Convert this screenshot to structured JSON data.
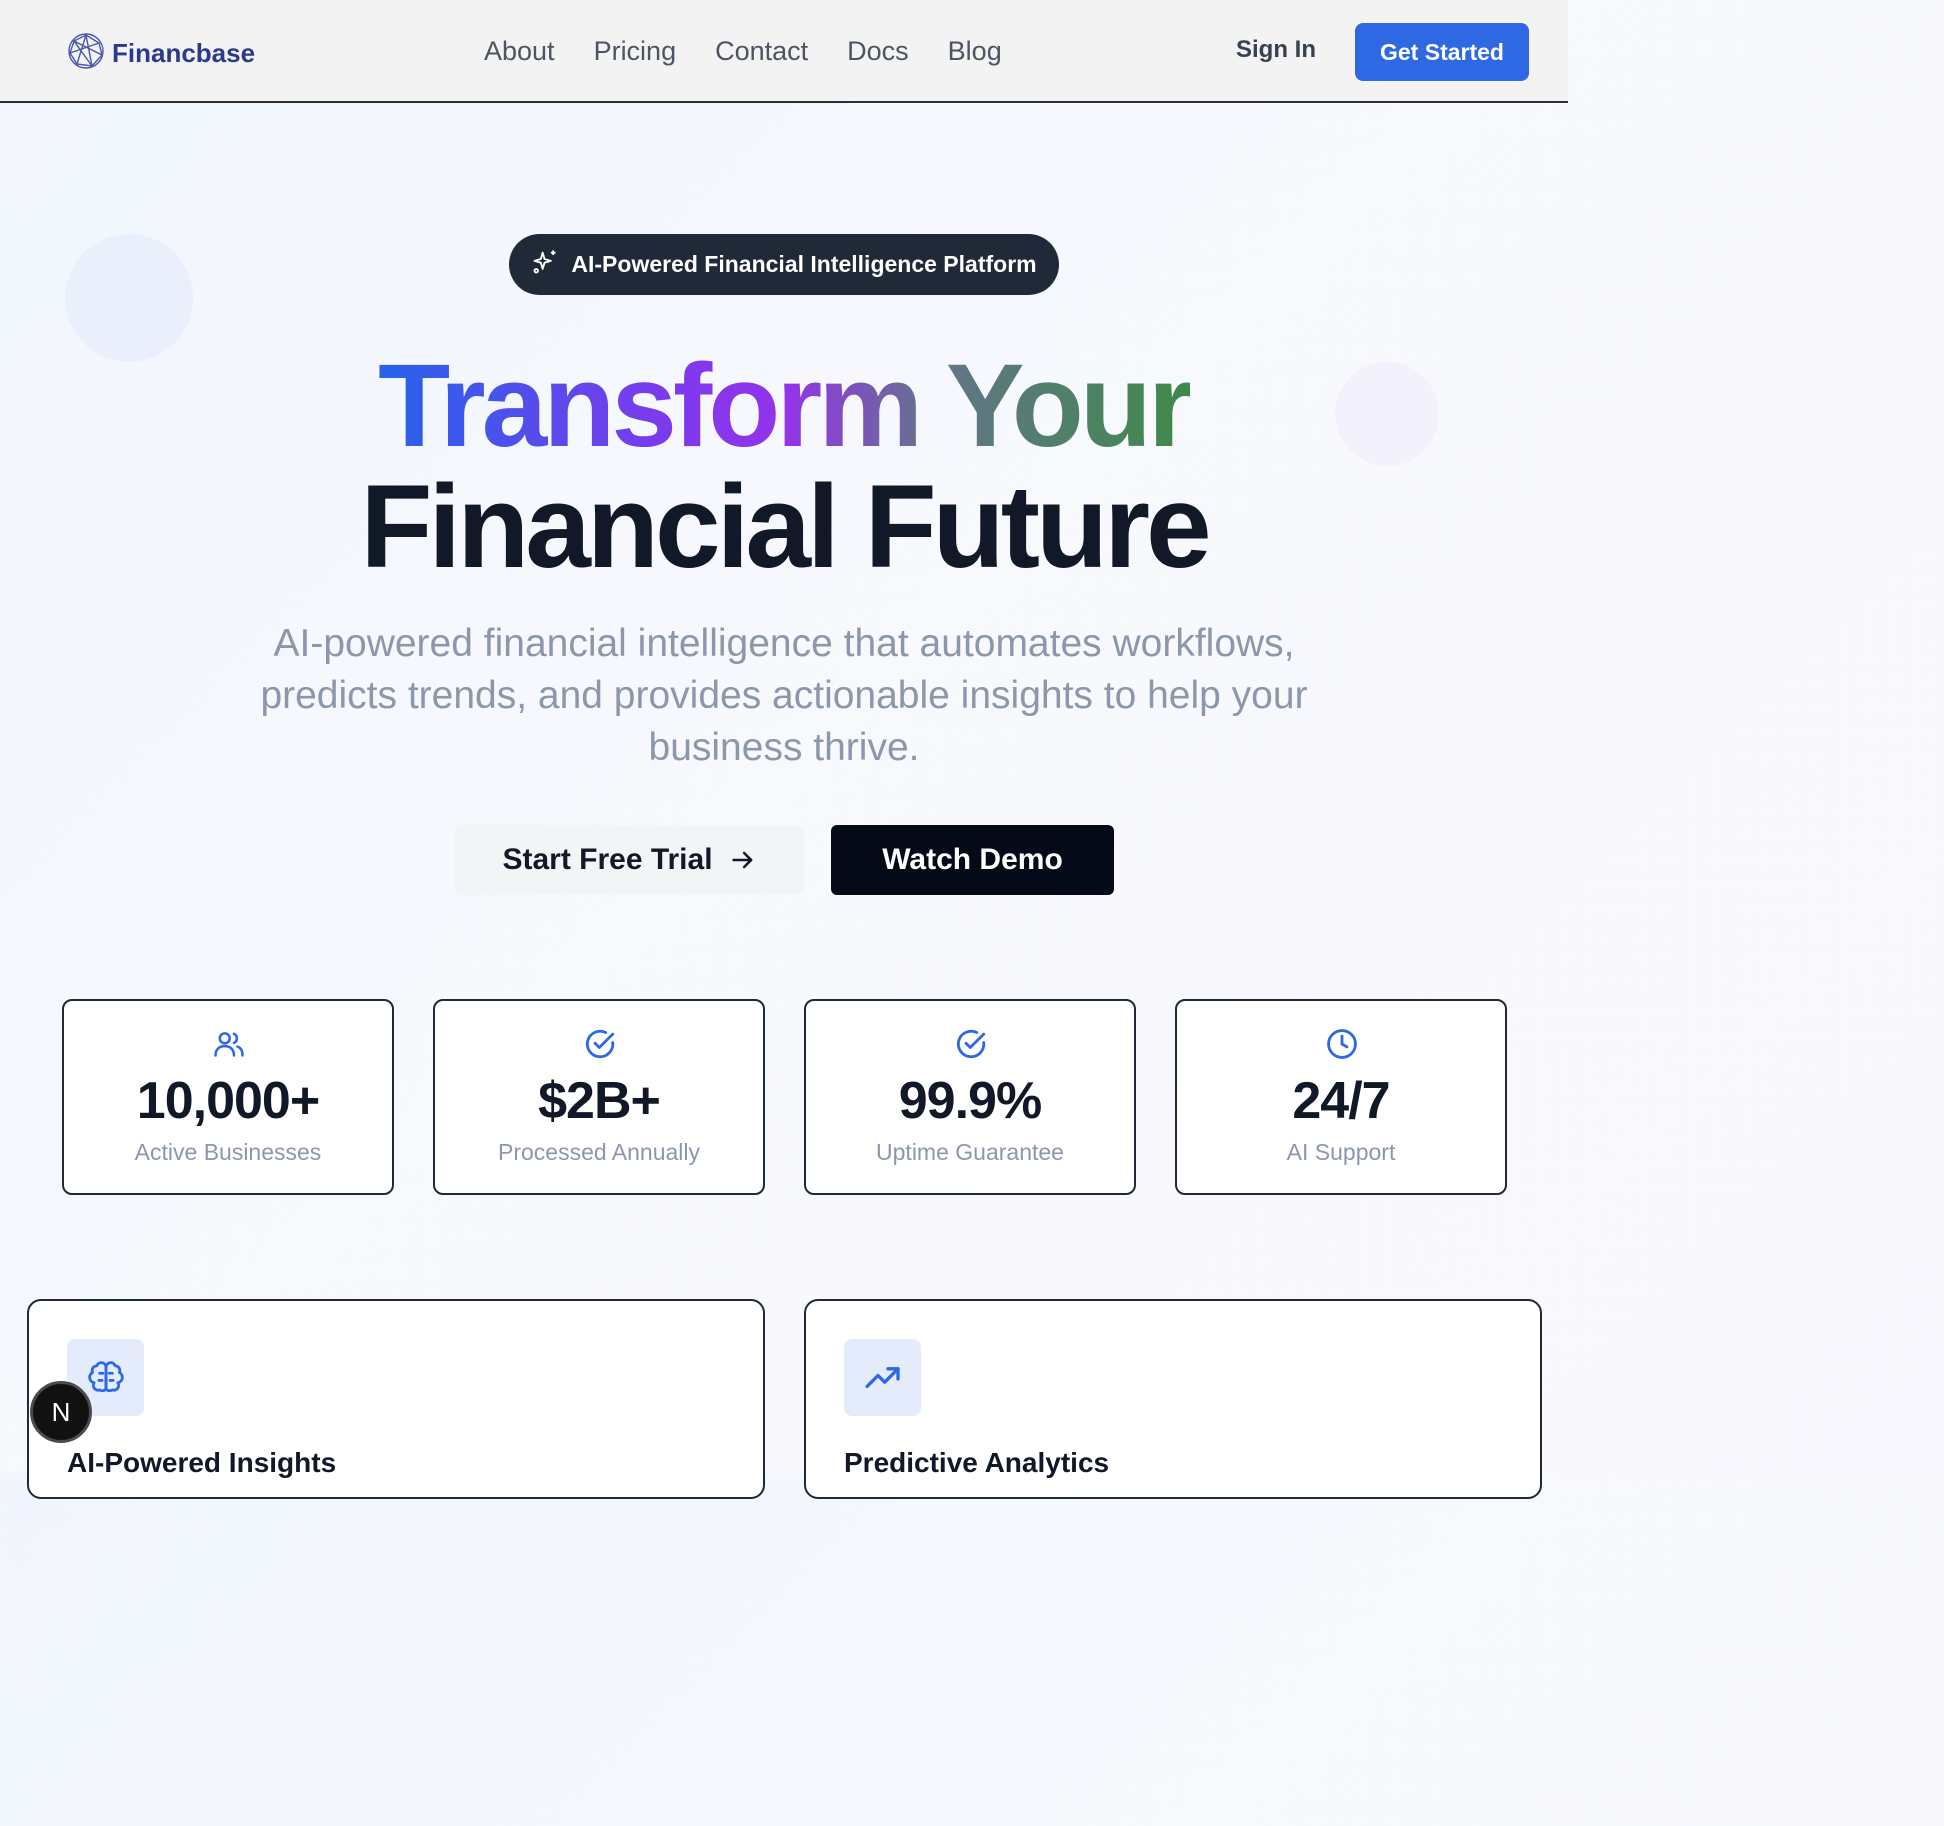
{
  "brand": {
    "name": "Financbase",
    "logo_icon": "network-globe-icon"
  },
  "nav": {
    "links": [
      "About",
      "Pricing",
      "Contact",
      "Docs",
      "Blog"
    ],
    "sign_in": "Sign In",
    "get_started": "Get Started"
  },
  "hero": {
    "badge": "AI-Powered Financial Intelligence Platform",
    "badge_icon": "sparkles-icon",
    "headline_line1": "Transform Your",
    "headline_line2": "Financial Future",
    "subtitle": "AI-powered financial intelligence that automates workflows, predicts trends, and provides actionable insights to help your business thrive.",
    "primary_cta": "Start Free Trial",
    "secondary_cta": "Watch Demo"
  },
  "stats": [
    {
      "icon": "users-icon",
      "value": "10,000+",
      "label": "Active Businesses"
    },
    {
      "icon": "check-circle-icon",
      "value": "$2B+",
      "label": "Processed Annually"
    },
    {
      "icon": "check-circle-icon",
      "value": "99.9%",
      "label": "Uptime Guarantee"
    },
    {
      "icon": "clock-icon",
      "value": "24/7",
      "label": "AI Support"
    }
  ],
  "features": [
    {
      "icon": "brain-icon",
      "title": "AI-Powered Insights"
    },
    {
      "icon": "trending-up-icon",
      "title": "Predictive Analytics"
    }
  ],
  "dev_badge": {
    "letter": "N"
  },
  "colors": {
    "accent": "#2f68e3",
    "dark": "#050a18",
    "muted": "#8c97ab"
  }
}
